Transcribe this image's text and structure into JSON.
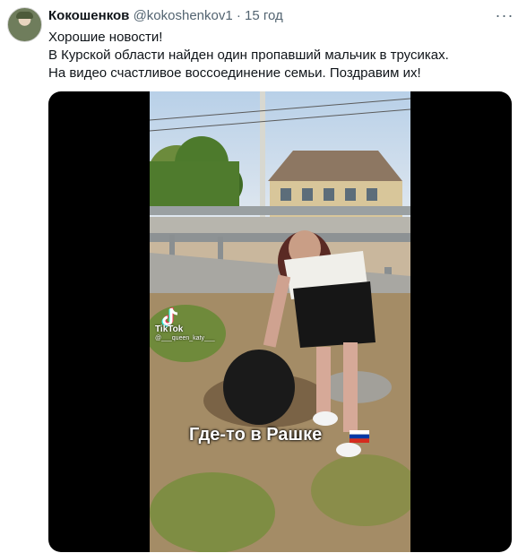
{
  "tweet": {
    "author_name": "Кокошенков",
    "handle": "@kokoshenkov1",
    "separator": "·",
    "time": "15 год",
    "more_icon": "more-horizontal-icon",
    "lines": [
      "Хорошие новости!",
      "В Курской области найден один пропавший мальчик в трусиках.",
      "На видео счастливое воссоединение семьи. Поздравим их!"
    ]
  },
  "video": {
    "watermark_label": "TikTok",
    "watermark_user": "@___queen_katy___",
    "caption": "Где-то в Рашке",
    "flag_icon": "russian-flag-icon",
    "colors": {
      "flag_white": "#ffffff",
      "flag_blue": "#0039a6",
      "flag_red": "#d52b1e"
    }
  }
}
